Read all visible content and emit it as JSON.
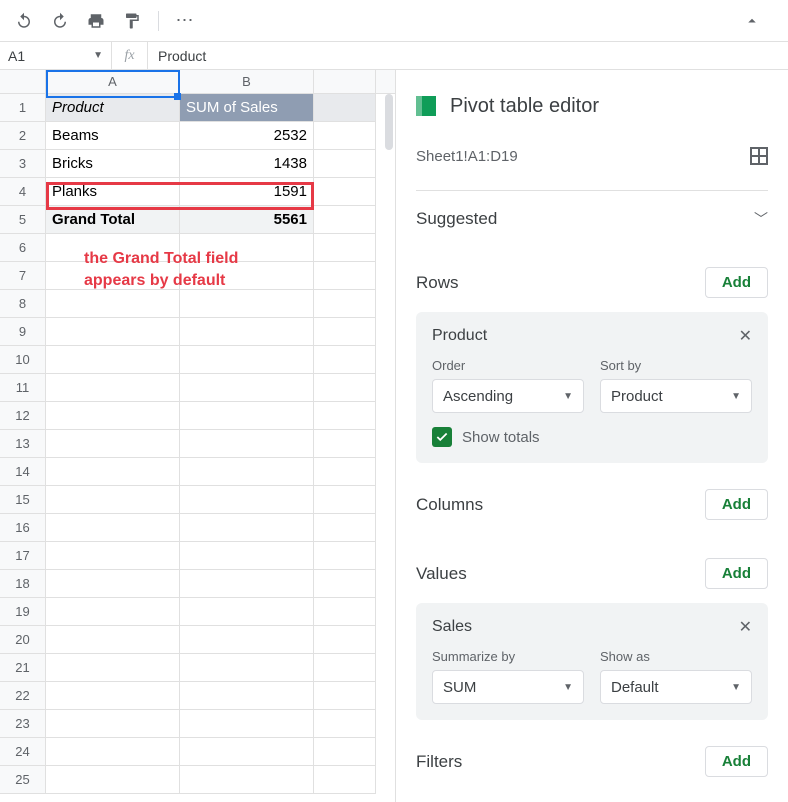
{
  "toolbar": {
    "name_box": "A1",
    "formula_value": "Product"
  },
  "sheet": {
    "columns": [
      "A",
      "B"
    ],
    "header": {
      "a": "Product",
      "b": "SUM of Sales"
    },
    "rows": [
      {
        "a": "Beams",
        "b": "2532"
      },
      {
        "a": "Bricks",
        "b": "1438"
      },
      {
        "a": "Planks",
        "b": "1591"
      },
      {
        "a": "Grand Total",
        "b": "5561"
      }
    ],
    "row_count": 25,
    "annotation_line1": "the Grand Total field",
    "annotation_line2": "appears by default"
  },
  "panel": {
    "title": "Pivot table editor",
    "range": "Sheet1!A1:D19",
    "suggested_label": "Suggested",
    "add_label": "Add",
    "rows_label": "Rows",
    "columns_label": "Columns",
    "values_label": "Values",
    "filters_label": "Filters",
    "rows_card": {
      "title": "Product",
      "order_label": "Order",
      "order_value": "Ascending",
      "sortby_label": "Sort by",
      "sortby_value": "Product",
      "show_totals_label": "Show totals",
      "show_totals_checked": true
    },
    "values_card": {
      "title": "Sales",
      "summarize_label": "Summarize by",
      "summarize_value": "SUM",
      "showas_label": "Show as",
      "showas_value": "Default"
    }
  }
}
